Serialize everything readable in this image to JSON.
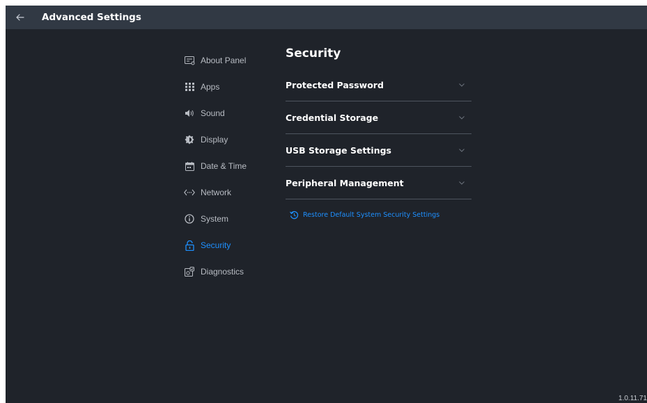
{
  "header": {
    "title": "Advanced Settings",
    "back_icon": "arrow-left-icon"
  },
  "sidebar": {
    "items": [
      {
        "label": "About Panel",
        "icon": "about-panel-icon"
      },
      {
        "label": "Apps",
        "icon": "apps-grid-icon"
      },
      {
        "label": "Sound",
        "icon": "speaker-icon"
      },
      {
        "label": "Display",
        "icon": "display-brightness-icon"
      },
      {
        "label": "Date & Time",
        "icon": "calendar-icon"
      },
      {
        "label": "Network",
        "icon": "network-icon"
      },
      {
        "label": "System",
        "icon": "info-icon"
      },
      {
        "label": "Security",
        "icon": "lock-icon",
        "active": true
      },
      {
        "label": "Diagnostics",
        "icon": "diagnostics-icon"
      }
    ]
  },
  "main": {
    "heading": "Security",
    "sections": [
      {
        "label": "Protected Password",
        "expanded": false
      },
      {
        "label": "Credential Storage",
        "expanded": false
      },
      {
        "label": "USB Storage Settings",
        "expanded": false
      },
      {
        "label": "Peripheral Management",
        "expanded": false
      }
    ],
    "restore_label": "Restore Default System Security Settings"
  },
  "footer": {
    "version": "1.0.11.71"
  },
  "colors": {
    "accent": "#1e90ff",
    "background": "#1f232a",
    "topbar": "#313944",
    "divider": "#4e555f"
  }
}
